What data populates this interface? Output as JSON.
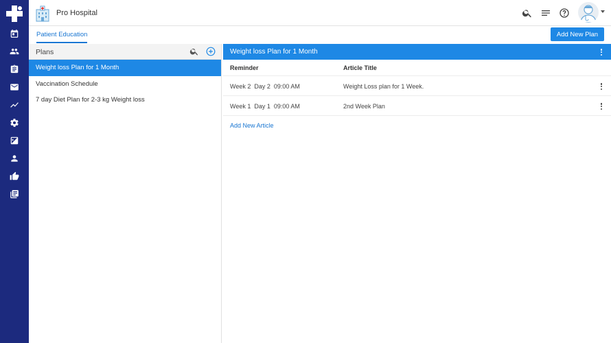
{
  "header": {
    "hospital_name": "Pro Hospital"
  },
  "subheader": {
    "tab_label": "Patient Education",
    "add_plan_label": "Add New Plan"
  },
  "plans": {
    "title": "Plans",
    "items": [
      {
        "label": "Weight loss Plan for 1 Month",
        "active": true
      },
      {
        "label": "Vaccination Schedule",
        "active": false
      },
      {
        "label": "7 day Diet Plan for 2-3 kg Weight loss",
        "active": false
      }
    ]
  },
  "detail": {
    "title": "Weight loss Plan for 1 Month",
    "columns": {
      "reminder": "Reminder",
      "article": "Article Title"
    },
    "rows": [
      {
        "reminder": "Week 2  Day 2  09:00 AM",
        "article": "Weight Loss plan for 1 Week."
      },
      {
        "reminder": "Week 1  Day 1  09:00 AM",
        "article": "2nd Week Plan"
      }
    ],
    "add_article_label": "Add New Article"
  },
  "colors": {
    "sidebar": "#1c2a7e",
    "accent": "#1e88e5",
    "link": "#1976d2"
  },
  "icons": {
    "rail": [
      "calendar-icon",
      "people-icon",
      "clipboard-icon",
      "mail-icon",
      "trending-icon",
      "settings-icon",
      "image-icon",
      "person-icon",
      "thumbs-up-icon",
      "library-icon"
    ],
    "topbar": [
      "search-icon",
      "notes-icon",
      "help-icon",
      "doctor-avatar"
    ]
  }
}
